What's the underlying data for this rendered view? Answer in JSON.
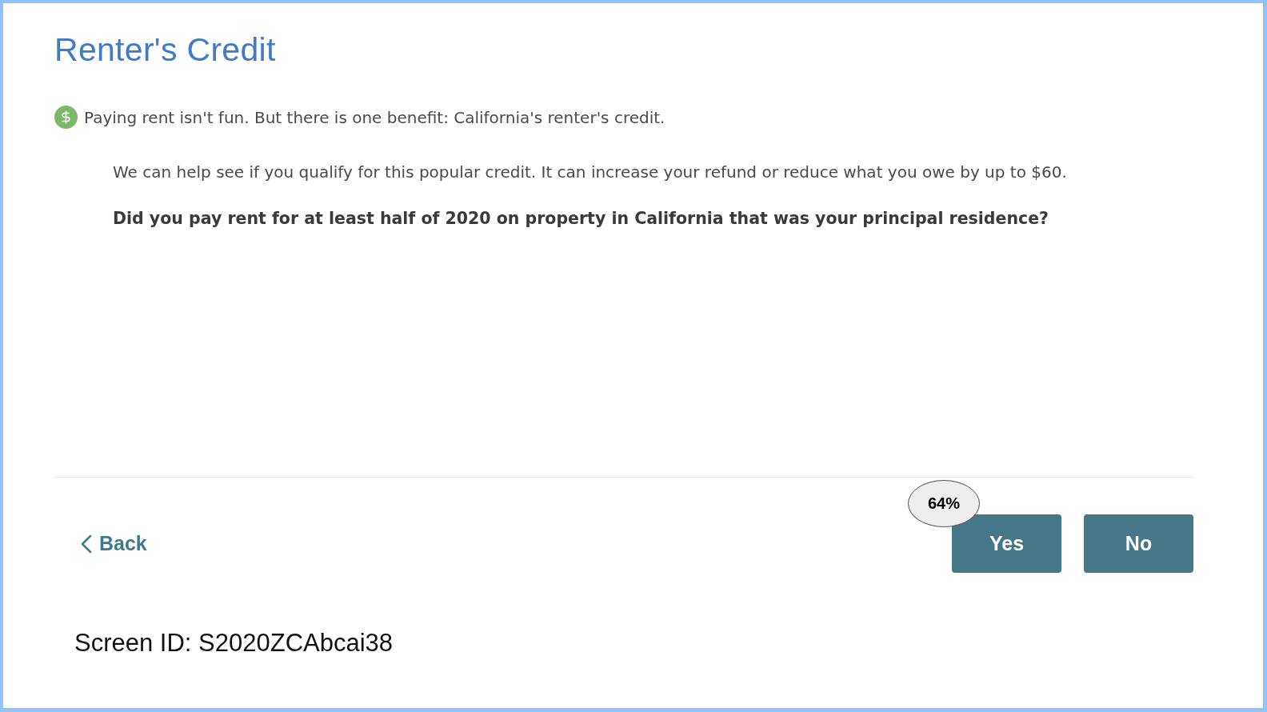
{
  "page": {
    "title": "Renter's Credit",
    "intro": "Paying rent isn't fun. But there is one benefit: California's renter's credit.",
    "description": "We can help see if you qualify for this popular credit. It can increase your refund or reduce what you owe by up to $60.",
    "question": "Did you pay rent for at least half of 2020 on property in California that was your principal residence?"
  },
  "navigation": {
    "back": "Back",
    "answers": [
      {
        "label": "Yes"
      },
      {
        "label": "No"
      }
    ]
  },
  "progress_badge": "64%",
  "screen_id": "Screen ID: S2020ZCAbcai38"
}
